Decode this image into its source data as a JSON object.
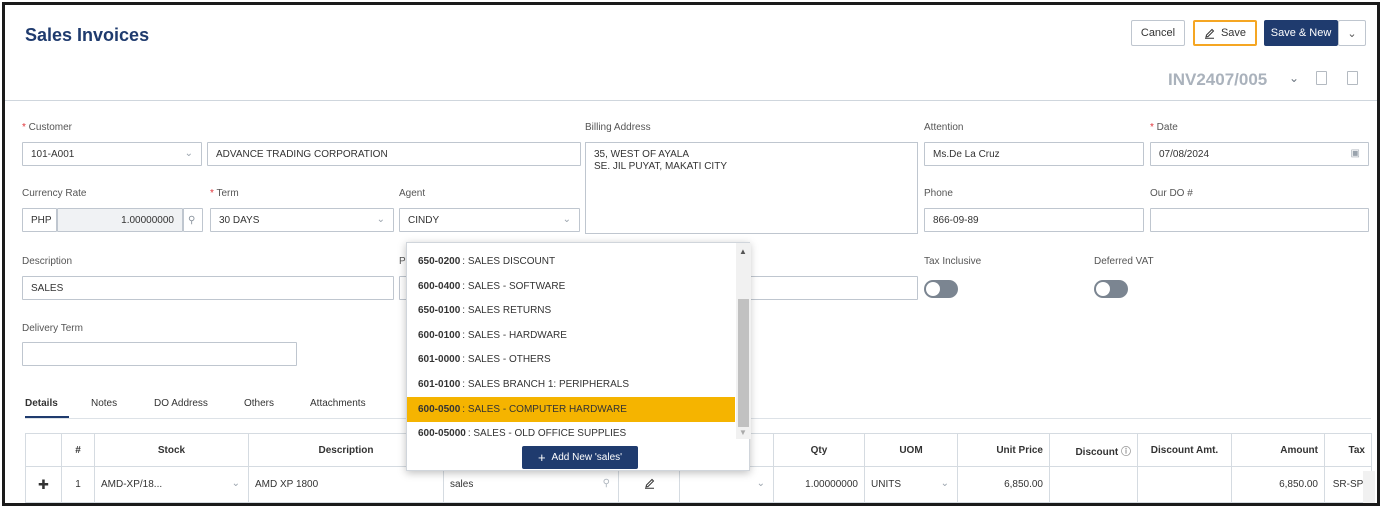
{
  "header": {
    "title": "Sales Invoices",
    "cancel_label": "Cancel",
    "save_label": "Save",
    "save_new_label": "Save & New",
    "invoice_no": "INV2407/005"
  },
  "form": {
    "customer_label": "Customer",
    "customer_code": "101-A001",
    "customer_name": "ADVANCE TRADING CORPORATION",
    "billing_label": "Billing Address",
    "billing_line1": "35, WEST OF AYALA",
    "billing_line2": "SE. JIL PUYAT, MAKATI CITY",
    "attention_label": "Attention",
    "attention": "Ms.De La Cruz",
    "date_label": "Date",
    "date": "07/08/2024",
    "currency_label": "Currency Rate",
    "currency": "PHP",
    "rate": "1.00000000",
    "term_label": "Term",
    "term": "30 DAYS",
    "agent_label": "Agent",
    "agent": "CINDY",
    "phone_label": "Phone",
    "phone": "866-09-89",
    "our_do_label": "Our DO #",
    "our_do": "",
    "description_label": "Description",
    "description": "SALES",
    "p_label": "P",
    "tax_inclusive_label": "Tax Inclusive",
    "deferred_vat_label": "Deferred VAT",
    "delivery_term_label": "Delivery Term",
    "delivery_term": ""
  },
  "tabs": [
    "Details",
    "Notes",
    "DO Address",
    "Others",
    "Attachments"
  ],
  "dropdown": {
    "items": [
      {
        "code": "650-0200",
        "name": " : SALES DISCOUNT"
      },
      {
        "code": "600-0400",
        "name": " : SALES - SOFTWARE"
      },
      {
        "code": "650-0100",
        "name": " : SALES RETURNS"
      },
      {
        "code": "600-0100",
        "name": " : SALES - HARDWARE"
      },
      {
        "code": "601-0000",
        "name": " : SALES - OTHERS"
      },
      {
        "code": "601-0100",
        "name": " : SALES BRANCH 1: PERIPHERALS"
      },
      {
        "code": "600-0500",
        "name": " : SALES - COMPUTER HARDWARE"
      },
      {
        "code": "600-05000",
        "name": " : SALES - OLD OFFICE SUPPLIES"
      }
    ],
    "selected_index": 6,
    "add_label": "Add New 'sales'"
  },
  "grid": {
    "headers": {
      "num": "#",
      "stock": "Stock",
      "description": "Description",
      "qty": "Qty",
      "uom": "UOM",
      "unit_price": "Unit Price",
      "discount": "Discount",
      "discount_amt": "Discount Amt.",
      "amount": "Amount",
      "tax": "Tax"
    },
    "row": {
      "num": "1",
      "stock": "AMD-XP/18...",
      "description": "AMD XP 1800",
      "account": "sales",
      "qty": "1.00000000",
      "uom": "UNITS",
      "unit_price": "6,850.00",
      "discount": "",
      "discount_amt": "",
      "amount": "6,850.00",
      "tax": "SR-SP"
    }
  },
  "colors": {
    "brand": "#1f3b6e",
    "highlight": "#f5b400",
    "save_border": "#f5a623"
  }
}
